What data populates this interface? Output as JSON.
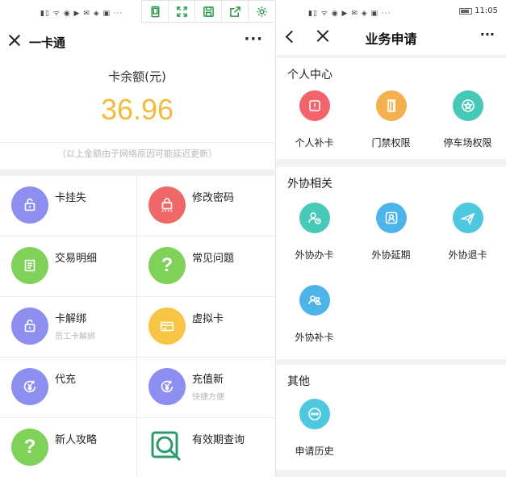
{
  "left_screen": {
    "header": {
      "title": "一卡通"
    },
    "balance": {
      "label": "卡余额(元)",
      "amount": "36.96",
      "note": "（以上金额由于网络原因可能延迟更新）"
    },
    "grid": [
      {
        "name": "卡挂失",
        "sub": "",
        "icon": "lock-icon",
        "color": "#8c8ff0"
      },
      {
        "name": "修改密码",
        "sub": "",
        "icon": "password-lock-icon",
        "color": "#f06767"
      },
      {
        "name": "交易明细",
        "sub": "",
        "icon": "receipt-icon",
        "color": "#7fd15a"
      },
      {
        "name": "常见问题",
        "sub": "",
        "icon": "question-icon",
        "color": "#7fd15a"
      },
      {
        "name": "卡解绑",
        "sub": "员工卡解绑",
        "icon": "unlock-icon",
        "color": "#8c8ff0"
      },
      {
        "name": "虚拟卡",
        "sub": "",
        "icon": "card-icon",
        "color": "#f7c446"
      },
      {
        "name": "代充",
        "sub": "",
        "icon": "yuan-recharge-icon",
        "color": "#8c8ff0"
      },
      {
        "name": "充值新",
        "sub": "快捷方便",
        "icon": "yuan-recharge-icon",
        "color": "#8c8ff0"
      },
      {
        "name": "新人攻略",
        "sub": "",
        "icon": "question-icon",
        "color": "#7fd15a"
      },
      {
        "name": "有效期查询",
        "sub": "",
        "icon": "search-icon",
        "color": "#2e9a6a"
      }
    ]
  },
  "right_screen": {
    "status": {
      "time": "11:05"
    },
    "header": {
      "title": "业务申请"
    },
    "sections": [
      {
        "title": "个人中心",
        "items": [
          {
            "label": "个人补卡",
            "icon": "alert-card-icon",
            "color": "#f2636b"
          },
          {
            "label": "门禁权限",
            "icon": "door-icon",
            "color": "#f5b04e"
          },
          {
            "label": "停车场权限",
            "icon": "star-badge-icon",
            "color": "#46c9b6"
          }
        ]
      },
      {
        "title": "外协相关",
        "items": [
          {
            "label": "外协办卡",
            "icon": "person-clock-icon",
            "color": "#46c9b6"
          },
          {
            "label": "外协延期",
            "icon": "person-frame-icon",
            "color": "#4db4ea"
          },
          {
            "label": "外协退卡",
            "icon": "plane-icon",
            "color": "#4ec8de"
          },
          {
            "label": "外协补卡",
            "icon": "people-icon",
            "color": "#4db4ea"
          }
        ]
      },
      {
        "title": "其他",
        "items": [
          {
            "label": "申请历史",
            "icon": "more-dots-icon",
            "color": "#4ec8de"
          }
        ]
      }
    ]
  }
}
